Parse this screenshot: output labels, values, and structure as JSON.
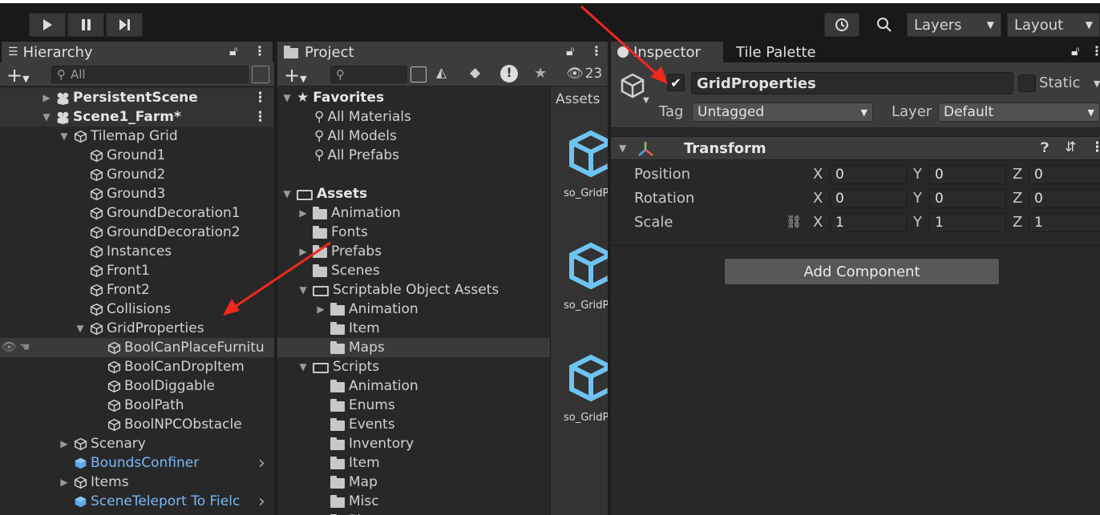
{
  "toolbar": {
    "play_icon": "play-icon",
    "pause_icon": "pause-icon",
    "step_icon": "step-icon",
    "layers_label": "Layers",
    "layout_label": "Layout"
  },
  "hierarchy": {
    "tab_label": "Hierarchy",
    "search_placeholder": "All",
    "items": [
      {
        "label": "PersistentScene",
        "depth": 0,
        "kind": "scene",
        "fold": "closed"
      },
      {
        "label": "Scene1_Farm*",
        "depth": 0,
        "kind": "scene",
        "fold": "open"
      },
      {
        "label": "Tilemap Grid",
        "depth": 1,
        "kind": "go",
        "fold": "open"
      },
      {
        "label": "Ground1",
        "depth": 2,
        "kind": "go",
        "fold": "none"
      },
      {
        "label": "Ground2",
        "depth": 2,
        "kind": "go",
        "fold": "none"
      },
      {
        "label": "Ground3",
        "depth": 2,
        "kind": "go",
        "fold": "none"
      },
      {
        "label": "GroundDecoration1",
        "depth": 2,
        "kind": "go",
        "fold": "none"
      },
      {
        "label": "GroundDecoration2",
        "depth": 2,
        "kind": "go",
        "fold": "none"
      },
      {
        "label": "Instances",
        "depth": 2,
        "kind": "go",
        "fold": "none"
      },
      {
        "label": "Front1",
        "depth": 2,
        "kind": "go",
        "fold": "none"
      },
      {
        "label": "Front2",
        "depth": 2,
        "kind": "go",
        "fold": "none"
      },
      {
        "label": "Collisions",
        "depth": 2,
        "kind": "go",
        "fold": "none"
      },
      {
        "label": "GridProperties",
        "depth": 2,
        "kind": "go",
        "fold": "open"
      },
      {
        "label": "BoolCanPlaceFurnitu",
        "depth": 3,
        "kind": "go",
        "fold": "none"
      },
      {
        "label": "BoolCanDropItem",
        "depth": 3,
        "kind": "go",
        "fold": "none"
      },
      {
        "label": "BoolDiggable",
        "depth": 3,
        "kind": "go",
        "fold": "none"
      },
      {
        "label": "BoolPath",
        "depth": 3,
        "kind": "go",
        "fold": "none"
      },
      {
        "label": "BoolNPCObstacle",
        "depth": 3,
        "kind": "go",
        "fold": "none"
      },
      {
        "label": "Scenary",
        "depth": 1,
        "kind": "go",
        "fold": "closed"
      },
      {
        "label": "BoundsConfiner",
        "depth": 1,
        "kind": "prefab",
        "fold": "none"
      },
      {
        "label": "Items",
        "depth": 1,
        "kind": "go",
        "fold": "closed"
      },
      {
        "label": "SceneTeleport To Fielc",
        "depth": 1,
        "kind": "prefab",
        "fold": "none"
      }
    ]
  },
  "project": {
    "tab_label": "Project",
    "hidden_count": "23",
    "favorites_label": "Favorites",
    "favorites": [
      "All Materials",
      "All Models",
      "All Prefabs"
    ],
    "assets_label": "Assets",
    "folders": [
      {
        "label": "Animation",
        "depth": 1,
        "fold": "closed",
        "open": false
      },
      {
        "label": "Fonts",
        "depth": 1,
        "fold": "none",
        "open": false
      },
      {
        "label": "Prefabs",
        "depth": 1,
        "fold": "closed",
        "open": false
      },
      {
        "label": "Scenes",
        "depth": 1,
        "fold": "none",
        "open": false
      },
      {
        "label": "Scriptable Object Assets",
        "depth": 1,
        "fold": "open",
        "open": true
      },
      {
        "label": "Animation",
        "depth": 2,
        "fold": "closed",
        "open": false
      },
      {
        "label": "Item",
        "depth": 2,
        "fold": "none",
        "open": false
      },
      {
        "label": "Maps",
        "depth": 2,
        "fold": "none",
        "open": false
      },
      {
        "label": "Scripts",
        "depth": 1,
        "fold": "open",
        "open": true
      },
      {
        "label": "Animation",
        "depth": 2,
        "fold": "none",
        "open": false
      },
      {
        "label": "Enums",
        "depth": 2,
        "fold": "none",
        "open": false
      },
      {
        "label": "Events",
        "depth": 2,
        "fold": "none",
        "open": false
      },
      {
        "label": "Inventory",
        "depth": 2,
        "fold": "none",
        "open": false
      },
      {
        "label": "Item",
        "depth": 2,
        "fold": "none",
        "open": false
      },
      {
        "label": "Map",
        "depth": 2,
        "fold": "none",
        "open": false
      },
      {
        "label": "Misc",
        "depth": 2,
        "fold": "none",
        "open": false
      },
      {
        "label": "Pl",
        "depth": 2,
        "fold": "none",
        "open": false
      }
    ],
    "breadcrumb": "Assets",
    "asset_labels": [
      "so_GridP",
      "so_GridP",
      "so_GridP"
    ]
  },
  "inspector": {
    "tab_label": "Inspector",
    "tab2_label": "Tile Palette",
    "object_name": "GridProperties",
    "static_label": "Static",
    "tag_label": "Tag",
    "tag_value": "Untagged",
    "layer_label": "Layer",
    "layer_value": "Default",
    "transform_label": "Transform",
    "rows": [
      {
        "label": "Position",
        "x": "0",
        "y": "0",
        "z": "0"
      },
      {
        "label": "Rotation",
        "x": "0",
        "y": "0",
        "z": "0"
      },
      {
        "label": "Scale",
        "x": "1",
        "y": "1",
        "z": "1"
      }
    ],
    "axis": {
      "x": "X",
      "y": "Y",
      "z": "Z"
    },
    "add_component_label": "Add Component"
  }
}
